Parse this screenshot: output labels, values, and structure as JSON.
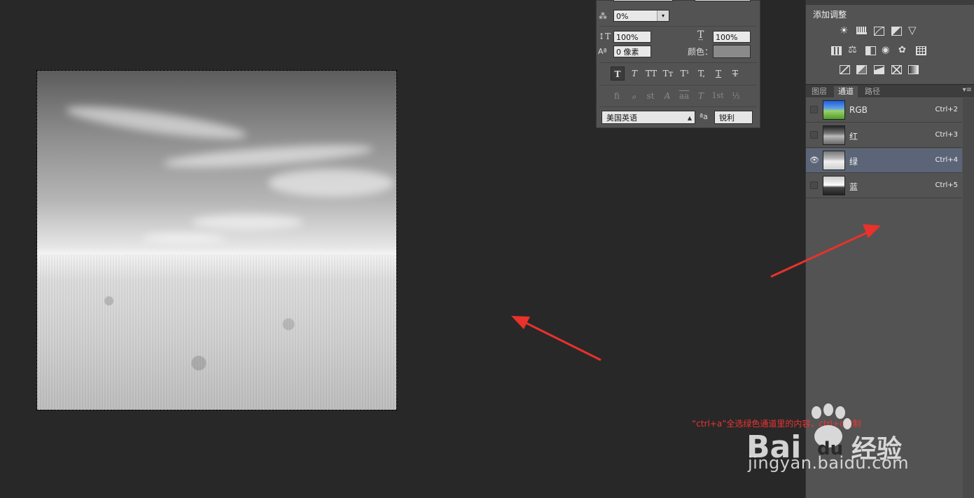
{
  "character_panel": {
    "tracking": "0%",
    "vertical_scale": "100%",
    "horizontal_scale": "100%",
    "baseline_shift": "0 像素",
    "color_label": "颜色：",
    "color_swatch": "#8a8a8a",
    "type_buttons": [
      "T",
      "T",
      "TT",
      "Tт",
      "T¹",
      "T,",
      "T",
      "T"
    ],
    "opentype_buttons": [
      "ﬁ",
      "ℴ",
      "st",
      "A",
      "aa",
      "T",
      "1st",
      "½"
    ],
    "language": "美国英语",
    "aa_label": "ªa",
    "antialias": "锐利"
  },
  "adjust_panel": {
    "title": "添加调整"
  },
  "channels_panel": {
    "tabs": [
      "图层",
      "通道",
      "路径"
    ],
    "active_tab": "通道",
    "channels": [
      {
        "name": "RGB",
        "shortcut": "Ctrl+2",
        "visible": false,
        "selected": false
      },
      {
        "name": "红",
        "shortcut": "Ctrl+3",
        "visible": false,
        "selected": false
      },
      {
        "name": "绿",
        "shortcut": "Ctrl+4",
        "visible": true,
        "selected": true
      },
      {
        "name": "蓝",
        "shortcut": "Ctrl+5",
        "visible": false,
        "selected": false
      }
    ]
  },
  "annotation": "“ctrl+a”全选绿色通道里的内容，ctrl+c复制",
  "watermark": {
    "brand": "Bai du 经验",
    "url": "jingyan.baidu.com"
  },
  "colors": {
    "arrow": "#e8322b",
    "selected_row": "#5c6577",
    "panel": "#535353"
  }
}
